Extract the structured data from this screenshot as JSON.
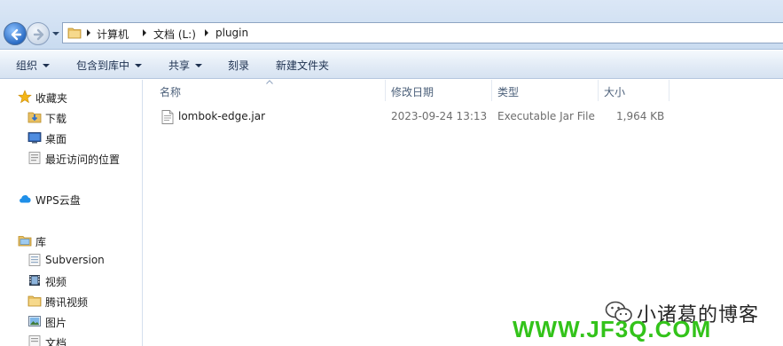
{
  "address": {
    "segments": [
      "计算机",
      "文档 (L:)",
      "plugin"
    ]
  },
  "toolbar": {
    "organize": "组织",
    "include_library": "包含到库中",
    "share": "共享",
    "burn": "刻录",
    "new_folder": "新建文件夹"
  },
  "sidebar": {
    "favorites": {
      "label": "收藏夹",
      "items": [
        "下载",
        "桌面",
        "最近访问的位置"
      ]
    },
    "wps": "WPS云盘",
    "libraries": {
      "label": "库",
      "items": [
        "Subversion",
        "视频",
        "腾讯视频",
        "图片",
        "文档"
      ]
    }
  },
  "columns": {
    "name": "名称",
    "date": "修改日期",
    "type": "类型",
    "size": "大小"
  },
  "files": [
    {
      "name": "lombok-edge.jar",
      "date": "2023-09-24 13:13",
      "type": "Executable Jar File",
      "size": "1,964 KB"
    }
  ],
  "watermark": {
    "blog": "小诸葛的博客",
    "site": "WWW.JF3Q.COM"
  }
}
